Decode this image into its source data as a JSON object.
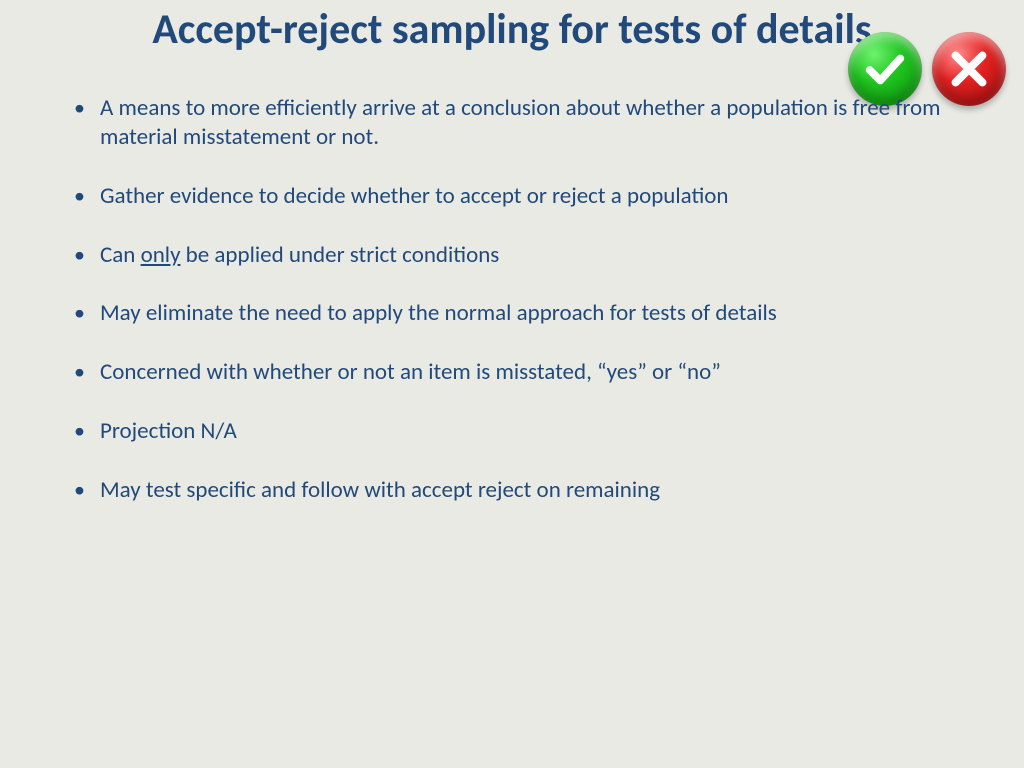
{
  "title": "Accept-reject sampling for tests of details",
  "bullets": [
    {
      "pre": "A means to more efficiently arrive at a conclusion about whether a population is free from material misstatement or not."
    },
    {
      "pre": "Gather evidence to decide whether to accept or reject a population"
    },
    {
      "pre": "Can ",
      "u": "only",
      "post": " be applied under strict conditions"
    },
    {
      "pre": "May eliminate the need to apply the normal approach for tests of details"
    },
    {
      "pre": "Concerned with whether or not an item is misstated, “yes” or “no”"
    },
    {
      "pre": "Projection N/A"
    },
    {
      "pre": "May test specific and follow with accept reject on remaining"
    }
  ],
  "icons": {
    "accept": "check-icon",
    "reject": "cross-icon"
  }
}
